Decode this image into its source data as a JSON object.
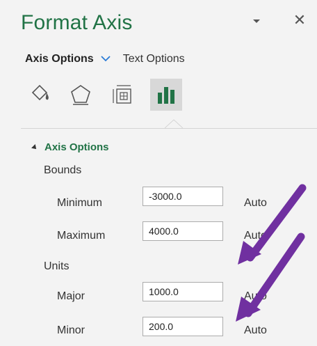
{
  "pane": {
    "title": "Format Axis",
    "close_glyph": "✕"
  },
  "tabs": {
    "axis_options": "Axis Options",
    "text_options": "Text Options"
  },
  "icons": [
    {
      "name": "fill-line-icon"
    },
    {
      "name": "effects-icon"
    },
    {
      "name": "size-properties-icon"
    },
    {
      "name": "axis-options-icon",
      "selected": true
    }
  ],
  "section": {
    "title": "Axis Options"
  },
  "bounds": {
    "label": "Bounds",
    "minimum": {
      "label": "Minimum",
      "value": "-3000.0",
      "auto": "Auto"
    },
    "maximum": {
      "label": "Maximum",
      "value": "4000.0",
      "auto": "Auto"
    }
  },
  "units": {
    "label": "Units",
    "major": {
      "label": "Major",
      "value": "1000.0",
      "auto": "Auto"
    },
    "minor": {
      "label": "Minor",
      "value": "200.0",
      "auto": "Auto"
    }
  },
  "colors": {
    "accent": "#217346",
    "annotation_arrow": "#7030a0"
  }
}
